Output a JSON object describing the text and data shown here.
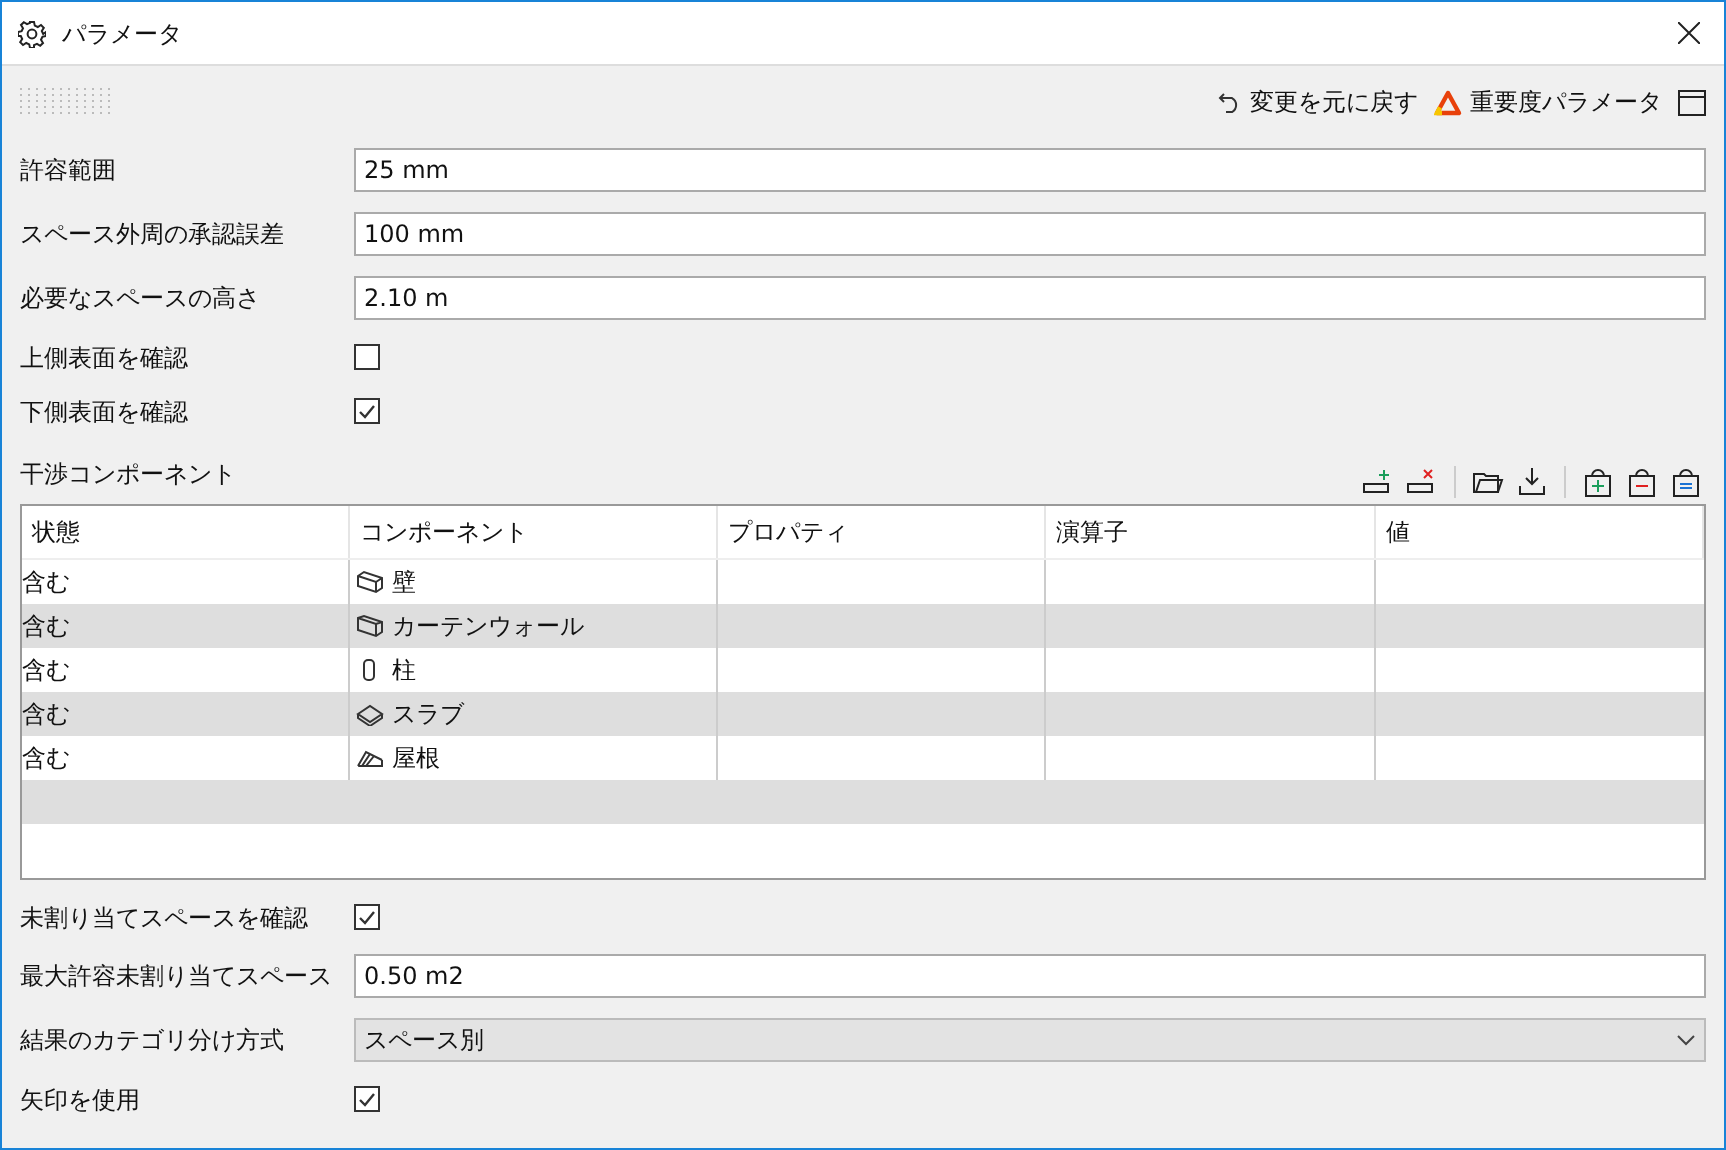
{
  "window": {
    "title": "パラメータ"
  },
  "header_actions": [
    {
      "kind": "undo",
      "label": "変更を元に戻す"
    },
    {
      "kind": "warning",
      "label": "重要度パラメータ"
    }
  ],
  "top_settings": [
    {
      "kind": "text",
      "label": "許容範囲",
      "value": "25 mm"
    },
    {
      "kind": "text",
      "label": "スペース外周の承認誤差",
      "value": "100 mm"
    },
    {
      "kind": "text",
      "label": "必要なスペースの高さ",
      "value": "2.10 m"
    },
    {
      "kind": "checkbox",
      "label": "上側表面を確認",
      "checked": false
    },
    {
      "kind": "checkbox",
      "label": "下側表面を確認",
      "checked": true
    }
  ],
  "interference": {
    "title": "干渉コンポーネント",
    "columns": [
      "状態",
      "コンポーネント",
      "プロパティ",
      "演算子",
      "値"
    ],
    "rows": [
      {
        "status": "含む",
        "component": "壁"
      },
      {
        "status": "含む",
        "component": "カーテンウォール"
      },
      {
        "status": "含む",
        "component": "柱"
      },
      {
        "status": "含む",
        "component": "スラブ"
      },
      {
        "status": "含む",
        "component": "屋根"
      }
    ]
  },
  "bottom_settings": [
    {
      "kind": "checkbox",
      "label": "未割り当てスペースを確認",
      "checked": true
    },
    {
      "kind": "text",
      "label": "最大許容未割り当てスペース",
      "value": "0.50 m2"
    },
    {
      "kind": "select",
      "label": "結果のカテゴリ分け方式",
      "value": "スペース別"
    },
    {
      "kind": "checkbox",
      "label": "矢印を使用",
      "checked": true
    }
  ]
}
